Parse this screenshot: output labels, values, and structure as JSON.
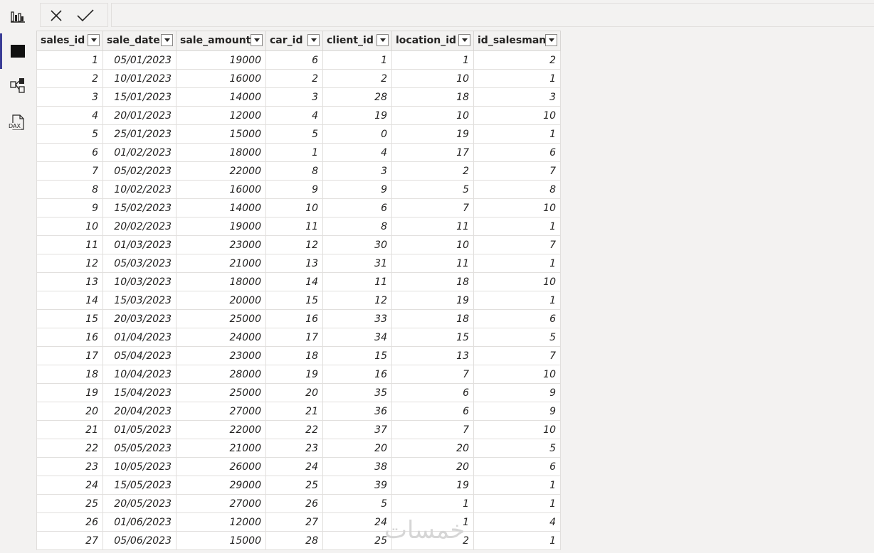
{
  "rail": {
    "items": [
      {
        "name": "report-view-icon"
      },
      {
        "name": "table-view-icon",
        "active": true
      },
      {
        "name": "model-view-icon"
      },
      {
        "name": "dax-query-view-icon",
        "label": "DAX"
      }
    ]
  },
  "formula_bar": {
    "cancel_icon": "close-icon",
    "commit_icon": "check-icon",
    "value": ""
  },
  "grid": {
    "columns": [
      "sales_id",
      "sale_date",
      "sale_amount",
      "car_id",
      "client_id",
      "location_id",
      "id_salesman"
    ],
    "rows": [
      [
        "1",
        "05/01/2023",
        "19000",
        "6",
        "1",
        "1",
        "2"
      ],
      [
        "2",
        "10/01/2023",
        "16000",
        "2",
        "2",
        "10",
        "1"
      ],
      [
        "3",
        "15/01/2023",
        "14000",
        "3",
        "28",
        "18",
        "3"
      ],
      [
        "4",
        "20/01/2023",
        "12000",
        "4",
        "19",
        "10",
        "10"
      ],
      [
        "5",
        "25/01/2023",
        "15000",
        "5",
        "0",
        "19",
        "1"
      ],
      [
        "6",
        "01/02/2023",
        "18000",
        "1",
        "4",
        "17",
        "6"
      ],
      [
        "7",
        "05/02/2023",
        "22000",
        "8",
        "3",
        "2",
        "7"
      ],
      [
        "8",
        "10/02/2023",
        "16000",
        "9",
        "9",
        "5",
        "8"
      ],
      [
        "9",
        "15/02/2023",
        "14000",
        "10",
        "6",
        "7",
        "10"
      ],
      [
        "10",
        "20/02/2023",
        "19000",
        "11",
        "8",
        "11",
        "1"
      ],
      [
        "11",
        "01/03/2023",
        "23000",
        "12",
        "30",
        "10",
        "7"
      ],
      [
        "12",
        "05/03/2023",
        "21000",
        "13",
        "31",
        "11",
        "1"
      ],
      [
        "13",
        "10/03/2023",
        "18000",
        "14",
        "11",
        "18",
        "10"
      ],
      [
        "14",
        "15/03/2023",
        "20000",
        "15",
        "12",
        "19",
        "1"
      ],
      [
        "15",
        "20/03/2023",
        "25000",
        "16",
        "33",
        "18",
        "6"
      ],
      [
        "16",
        "01/04/2023",
        "24000",
        "17",
        "34",
        "15",
        "5"
      ],
      [
        "17",
        "05/04/2023",
        "23000",
        "18",
        "15",
        "13",
        "7"
      ],
      [
        "18",
        "10/04/2023",
        "28000",
        "19",
        "16",
        "7",
        "10"
      ],
      [
        "19",
        "15/04/2023",
        "25000",
        "20",
        "35",
        "6",
        "9"
      ],
      [
        "20",
        "20/04/2023",
        "27000",
        "21",
        "36",
        "6",
        "9"
      ],
      [
        "21",
        "01/05/2023",
        "22000",
        "22",
        "37",
        "7",
        "10"
      ],
      [
        "22",
        "05/05/2023",
        "21000",
        "23",
        "20",
        "20",
        "5"
      ],
      [
        "23",
        "10/05/2023",
        "26000",
        "24",
        "38",
        "20",
        "6"
      ],
      [
        "24",
        "15/05/2023",
        "29000",
        "25",
        "39",
        "19",
        "1"
      ],
      [
        "25",
        "20/05/2023",
        "27000",
        "26",
        "5",
        "1",
        "1"
      ],
      [
        "26",
        "01/06/2023",
        "12000",
        "27",
        "24",
        "1",
        "4"
      ],
      [
        "27",
        "05/06/2023",
        "15000",
        "28",
        "25",
        "2",
        "1"
      ]
    ]
  },
  "watermark": "خمسات"
}
